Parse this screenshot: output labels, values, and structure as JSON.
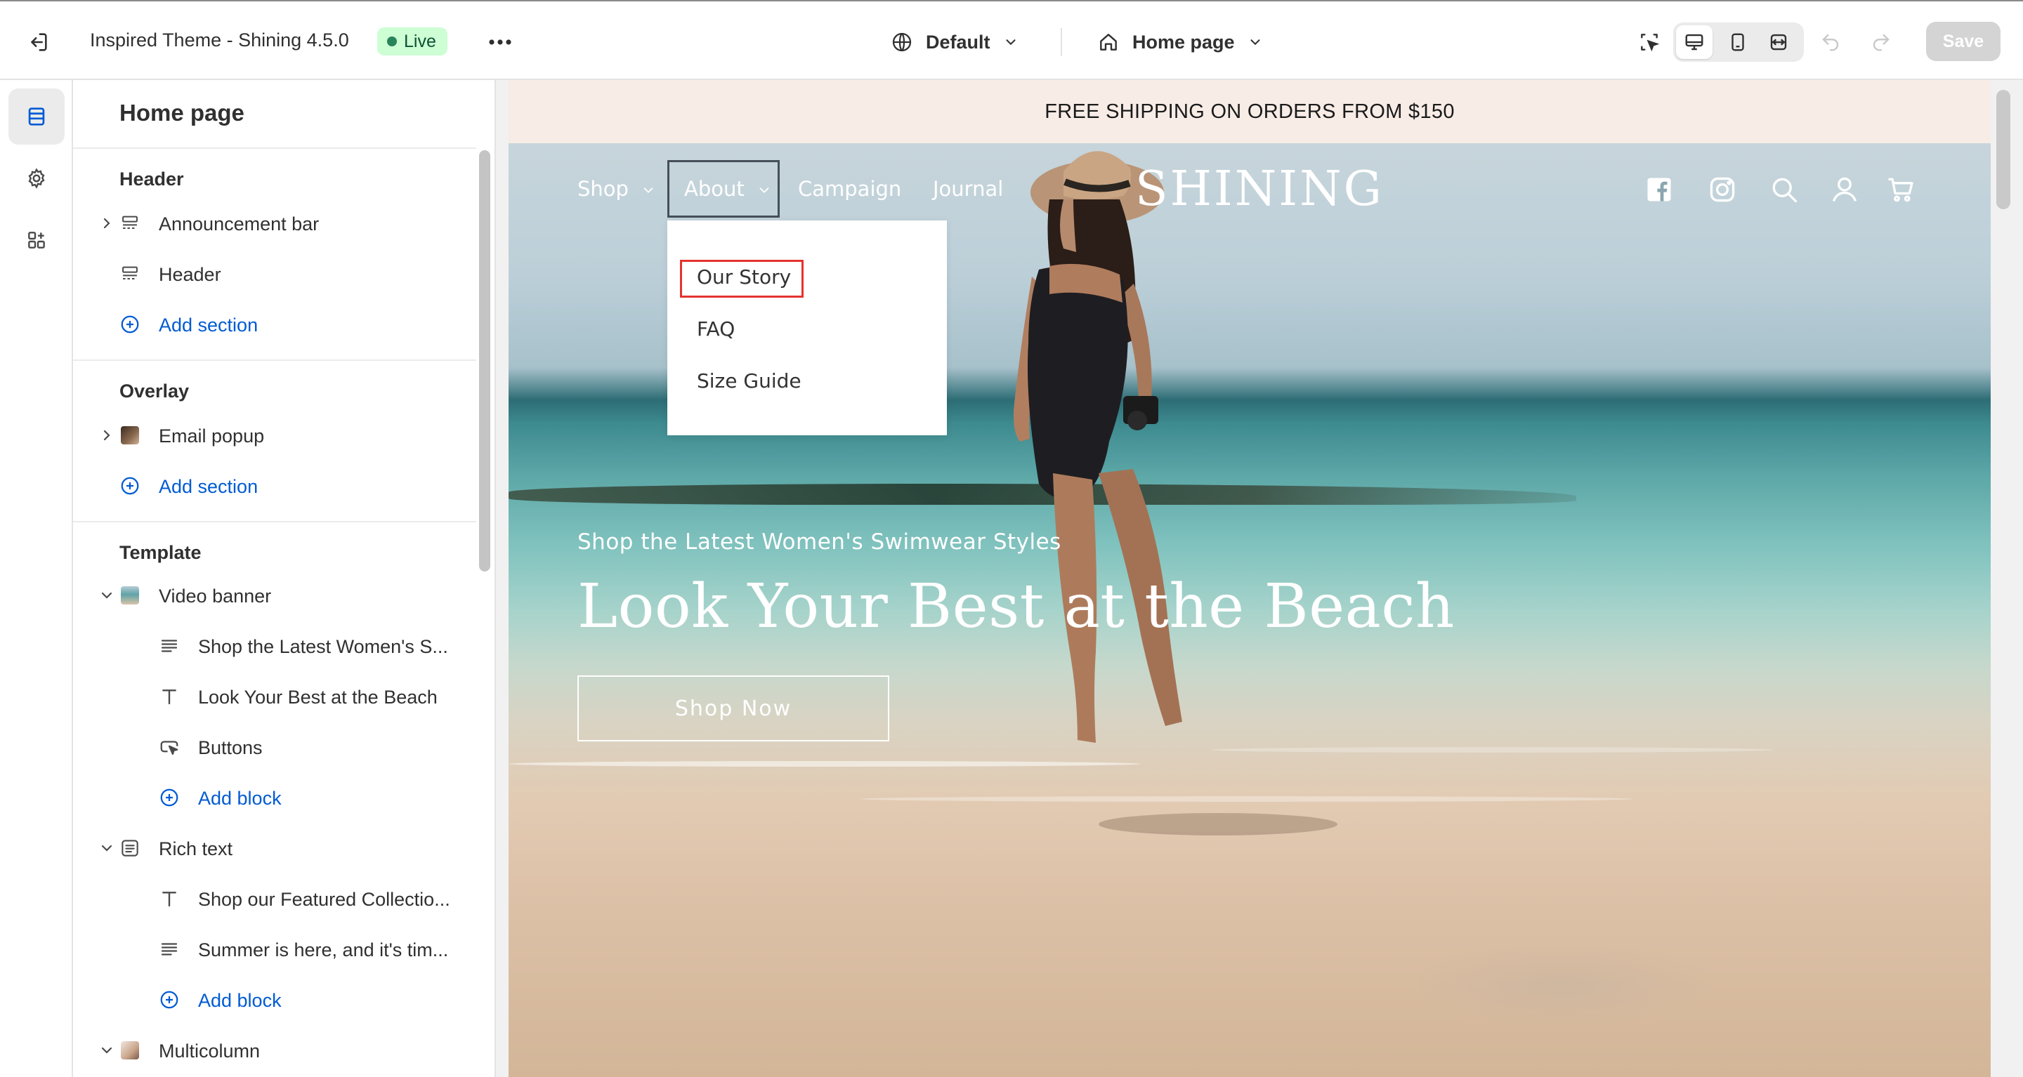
{
  "topbar": {
    "theme_name": "Inspired Theme - Shining 4.5.0",
    "live_label": "Live",
    "locale_label": "Default",
    "page_label": "Home page",
    "save_label": "Save"
  },
  "sidebar": {
    "title": "Home page",
    "groups": {
      "header": {
        "title": "Header",
        "items": [
          {
            "label": "Announcement bar",
            "icon": "section-icon"
          },
          {
            "label": "Header",
            "icon": "section-icon"
          }
        ],
        "add": "Add section"
      },
      "overlay": {
        "title": "Overlay",
        "items": [
          {
            "label": "Email popup",
            "icon": "image-thumb"
          }
        ],
        "add": "Add section"
      },
      "template": {
        "title": "Template",
        "video_banner": {
          "label": "Video banner",
          "blocks": [
            {
              "label": "Shop the Latest Women's S...",
              "icon": "text-lines-icon"
            },
            {
              "label": "Look Your Best at the Beach",
              "icon": "heading-t-icon"
            },
            {
              "label": "Buttons",
              "icon": "button-pointer-icon"
            }
          ],
          "add": "Add block"
        },
        "rich_text": {
          "label": "Rich text",
          "blocks": [
            {
              "label": "Shop our Featured Collectio...",
              "icon": "heading-t-icon"
            },
            {
              "label": "Summer is here, and it's tim...",
              "icon": "text-lines-icon"
            }
          ],
          "add": "Add block"
        },
        "multicolumn": {
          "label": "Multicolumn"
        }
      }
    }
  },
  "preview": {
    "announcement": "FREE SHIPPING ON ORDERS FROM $150",
    "nav": {
      "shop": "Shop",
      "about": "About",
      "campaign": "Campaign",
      "journal": "Journal"
    },
    "logo": "SHINING",
    "dropdown": [
      "Our Story",
      "FAQ",
      "Size Guide"
    ],
    "hero": {
      "subtitle": "Shop the Latest Women's Swimwear Styles",
      "title": "Look Your Best at the Beach",
      "button": "Shop Now"
    }
  },
  "colors": {
    "live_badge_bg": "#cdfed4",
    "link_blue": "#005bd3",
    "highlight_red": "#e3342f",
    "announcement_bg": "#f7ece6"
  }
}
